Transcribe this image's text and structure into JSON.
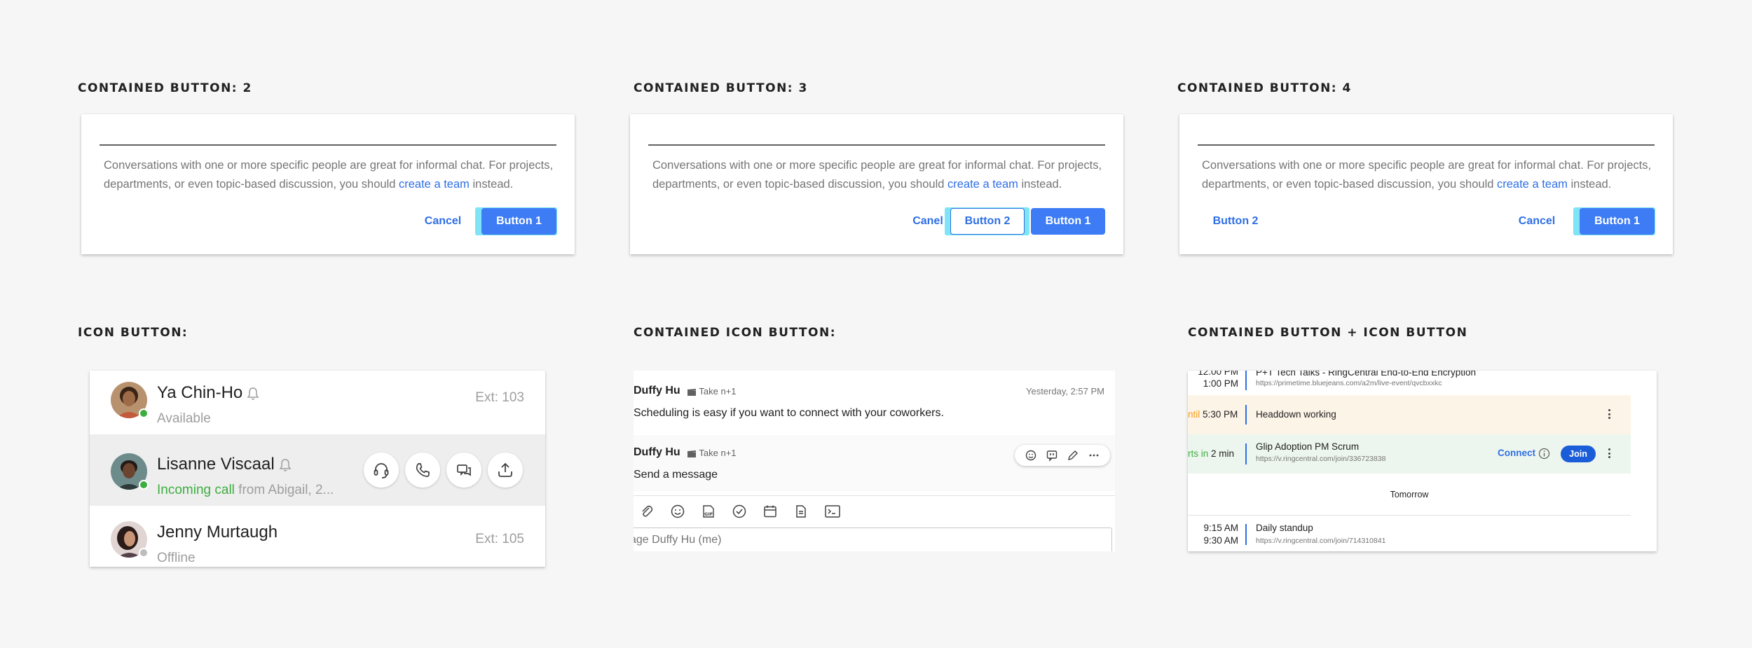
{
  "sections": {
    "contained_button_2": "CONTAINED BUTTON: 2",
    "contained_button_3": "CONTAINED BUTTON: 3",
    "contained_button_4": "CONTAINED BUTTON: 4",
    "icon_button": "ICON BUTTON:",
    "contained_icon_button": "CONTAINED ICON BUTTON:",
    "contained_plus_icon": "CONTAINED BUTTON + ICON BUTTON"
  },
  "dialog": {
    "text_before": "Conversations with one or more specific people are great for informal chat. For projects, departments, or even topic-based discussion, you should ",
    "link": "create a team",
    "text_after": " instead."
  },
  "dialog2": {
    "cancel": "Cancel",
    "primary": "Button 1"
  },
  "dialog3": {
    "cancel": "Canel",
    "secondary": "Button 2",
    "primary": "Button 1"
  },
  "dialog4": {
    "left": "Button 2",
    "cancel": "Cancel",
    "primary": "Button 1"
  },
  "contacts": [
    {
      "name": "Ya Chin-Ho",
      "status": "Available",
      "ext": "Ext: 103",
      "presence": "#3cae3f"
    },
    {
      "name": "Lisanne Viscaal",
      "status_highlight": "Incoming call",
      "status_rest": " from Abigail, 2...",
      "presence": "#3cae3f"
    },
    {
      "name": "Jenny Murtaugh",
      "status": "Offline",
      "ext": "Ext: 105",
      "presence": "#bdbdbd"
    }
  ],
  "chat": {
    "msg1": {
      "author": "Duffy Hu",
      "meta": "Take n+1",
      "text": "Scheduling is easy if you want to connect with your coworkers.",
      "time": "Yesterday, 2:57 PM"
    },
    "msg2": {
      "author": "Duffy Hu",
      "meta": "Take n+1",
      "text": "Send a message"
    },
    "compose_placeholder": "age Duffy Hu (me)"
  },
  "calendar": {
    "ev0": {
      "time_top": "12:00 PM",
      "time_bottom": "1:00 PM",
      "title": "P+T Tech Talks - RingCentral End-to-End Encryption",
      "url": "https://primetime.bluejeans.com/a2m/live-event/qvcbxxkc"
    },
    "ev1": {
      "time_prefix": "ntil",
      "time": "5:30 PM",
      "title": "Headdown working"
    },
    "ev2": {
      "time_prefix": "rts in",
      "time": "2 min",
      "title": "Glip Adoption PM Scrum",
      "url": "https://v.ringcentral.com/join/336723838",
      "connect": "Connect",
      "join": "Join"
    },
    "divider": "Tomorrow",
    "ev3": {
      "time_top": "9:15 AM",
      "time_bottom": "9:30 AM",
      "title": "Daily standup",
      "url": "https://v.ringcentral.com/join/714310841"
    }
  },
  "colors": {
    "primary": "#3d7cf5",
    "link": "#2f6fe4",
    "focus": "#7fe4f5",
    "online": "#3cae3f",
    "warn_bg": "#fdf4e8",
    "success_bg": "#edf6ee"
  }
}
